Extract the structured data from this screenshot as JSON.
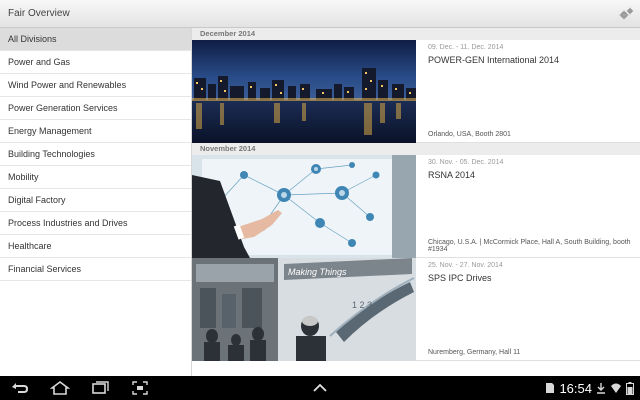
{
  "app": {
    "title": "Fair Overview"
  },
  "sidebar": {
    "items": [
      {
        "label": "All Divisions"
      },
      {
        "label": "Power and Gas"
      },
      {
        "label": "Wind Power and Renewables"
      },
      {
        "label": "Power Generation Services"
      },
      {
        "label": "Energy Management"
      },
      {
        "label": "Building Technologies"
      },
      {
        "label": "Mobility"
      },
      {
        "label": "Digital Factory"
      },
      {
        "label": "Process Industries and Drives"
      },
      {
        "label": "Healthcare"
      },
      {
        "label": "Financial Services"
      }
    ]
  },
  "events": {
    "month1": "December 2014",
    "month2": "November 2014",
    "items": [
      {
        "dates": "09. Dec. - 11. Dec. 2014",
        "title": "POWER-GEN International 2014",
        "location": "Orlando, USA, Booth 2801"
      },
      {
        "dates": "30. Nov. - 05. Dec. 2014",
        "title": "RSNA 2014",
        "location": "Chicago, U.S.A. | McCormick Place, Hall A, South Building, booth #1934"
      },
      {
        "dates": "25. Nov. - 27. Nov. 2014",
        "title": "SPS IPC Drives",
        "location": "Nuremberg, Germany, Hall 11"
      }
    ]
  },
  "image_text": {
    "banner": "Making Things",
    "gauge": "1 2 3 4 5"
  },
  "status": {
    "time": "16:54"
  }
}
